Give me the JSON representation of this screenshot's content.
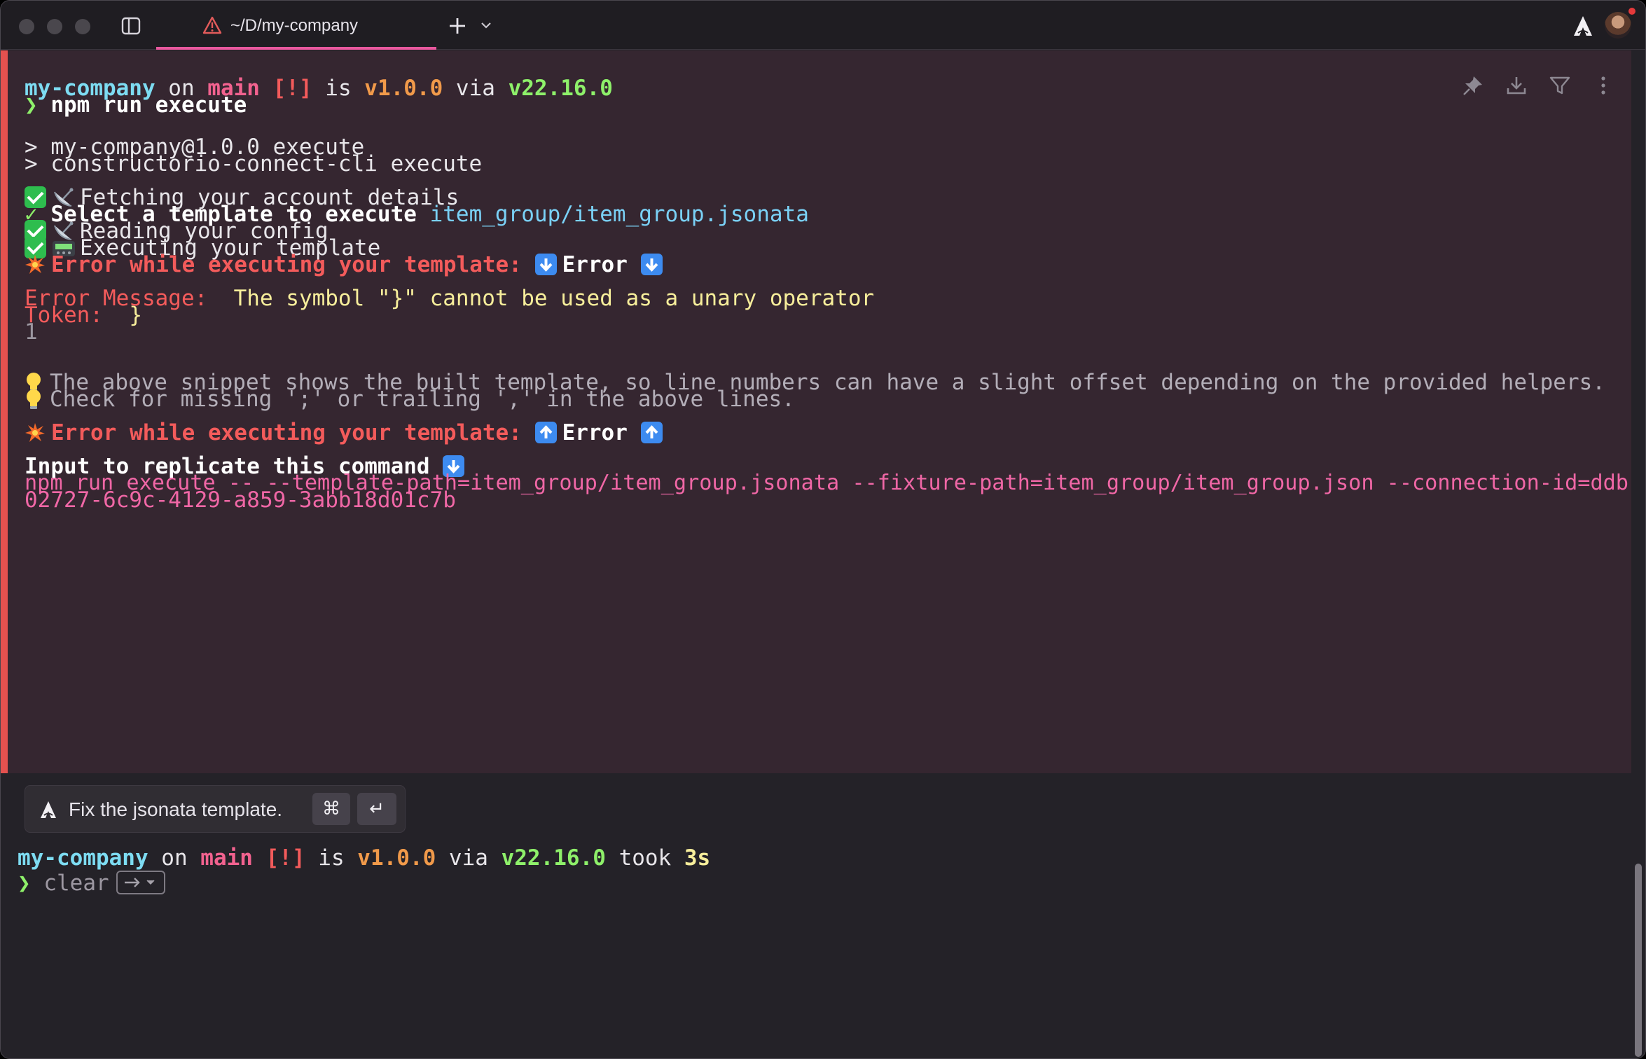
{
  "window": {
    "tab_title": "~/D/my-company",
    "icons": [
      "sidebar-toggle-icon",
      "warning-icon",
      "plus-icon",
      "chevron-down-icon",
      "app-logo-icon",
      "avatar"
    ]
  },
  "block_actions": [
    "pin-icon",
    "download-icon",
    "filter-icon",
    "more-vertical-icon"
  ],
  "prompt1": {
    "dir": "my-company",
    "on": " on ",
    "branch_icon": "",
    "branch": "main",
    "status": "[!]",
    "is": " is ",
    "pkg_icon": "",
    "version": "v1.0.0",
    "via": " via ",
    "node_icon": "",
    "node": "v22.16.0",
    "arrow": "❯",
    "command": "npm run execute"
  },
  "output": {
    "line1": "> my-company@1.0.0 execute",
    "line2": "> constructorio-connect-cli execute",
    "fetch": "Fetching your account details",
    "select_check": "✓",
    "select_label": "Select a template to execute",
    "select_value": "item_group/item_group.jsonata",
    "reading": "Reading your config",
    "executing": "Executing your template",
    "error_header": "Error while executing your template:",
    "error_word": "Error",
    "err_msg_label": "Error Message:",
    "err_msg_value": "The symbol \"}\" cannot be used as a unary operator",
    "token_label": "Token:",
    "token_value": "}",
    "line_no": "1",
    "hint1": "The above snippet shows the built template, so line numbers can have a slight offset depending on the provided helpers.",
    "hint2": "Check for missing ';' or trailing ',' in the above lines.",
    "replicate_label": "Input to replicate this command",
    "replicate_cmd1": "npm run execute -- --template-path=item_group/item_group.jsonata --fixture-path=item_group/item_group.json --connection-id=ddb",
    "replicate_cmd2": "02727-6c9c-4129-a859-3abb18d01c7b"
  },
  "suggestion": {
    "text": "Fix the jsonata template.",
    "key_cmd": "⌘",
    "key_enter": "↵"
  },
  "prompt2": {
    "dir": "my-company",
    "on": " on ",
    "branch": "main",
    "status": "[!]",
    "is": " is ",
    "version": "v1.0.0",
    "via": " via ",
    "node": "v22.16.0",
    "took": " took ",
    "duration": "3s",
    "arrow": "❯",
    "ghost_command": "clear"
  }
}
